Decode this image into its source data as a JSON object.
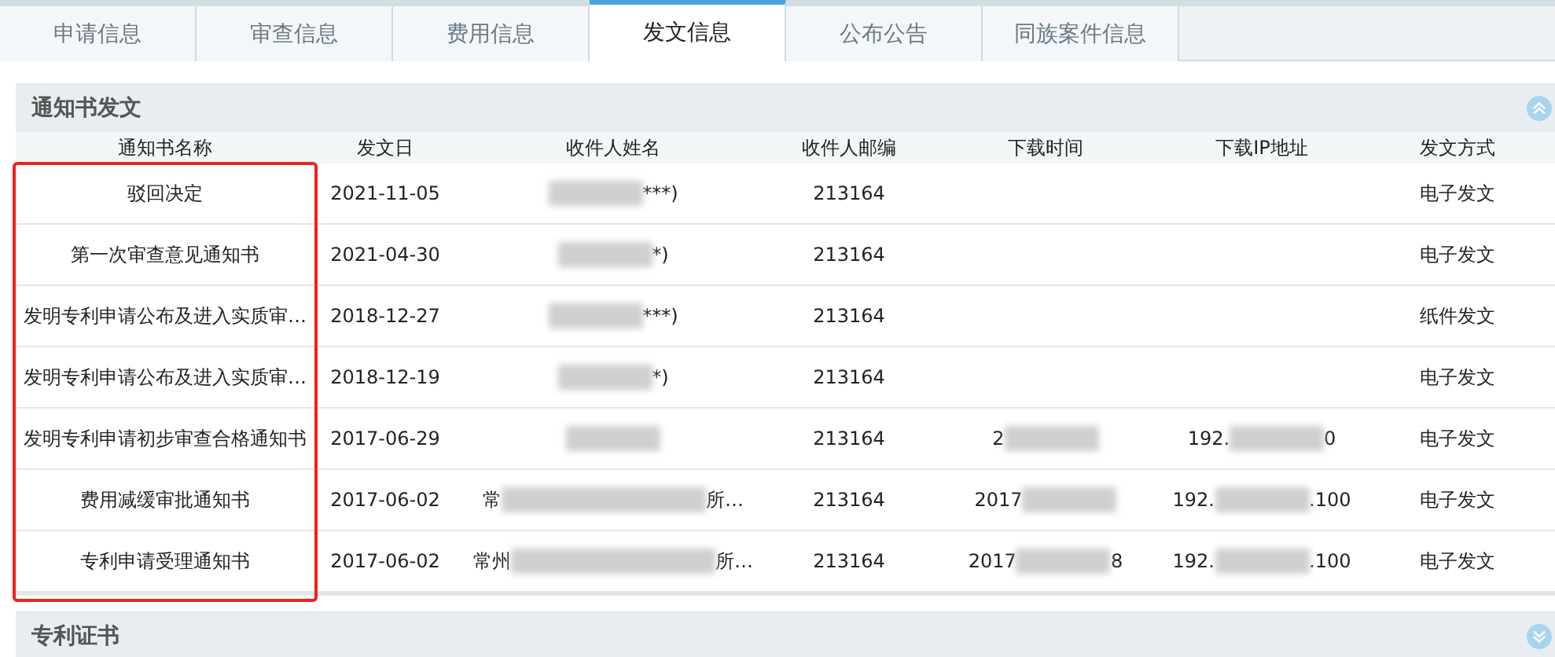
{
  "tabs": [
    {
      "label": "申请信息",
      "selected": false
    },
    {
      "label": "审查信息",
      "selected": false
    },
    {
      "label": "费用信息",
      "selected": false
    },
    {
      "label": "发文信息",
      "selected": true
    },
    {
      "label": "公布公告",
      "selected": false
    },
    {
      "label": "同族案件信息",
      "selected": false
    }
  ],
  "sections": [
    {
      "title": "通知书发文",
      "expanded": true,
      "table": {
        "highlight_first_column": true,
        "columns": [
          "通知书名称",
          "发文日",
          "收件人姓名",
          "收件人邮编",
          "下载时间",
          "下载IP地址",
          "发文方式"
        ],
        "rows": [
          {
            "name": "驳回决定",
            "date": "2021-11-05",
            "recipient": {
              "masked": true,
              "after": "***)"
            },
            "postcode": "213164",
            "method": "电子发文"
          },
          {
            "name": "第一次审查意见通知书",
            "date": "2021-04-30",
            "recipient": {
              "masked": true,
              "after": "*)"
            },
            "postcode": "213164",
            "method": "电子发文"
          },
          {
            "name": "发明专利申请公布及进入实质审…",
            "date": "2018-12-27",
            "recipient": {
              "masked": true,
              "after": "***)"
            },
            "postcode": "213164",
            "method": "纸件发文"
          },
          {
            "name": "发明专利申请公布及进入实质审…",
            "date": "2018-12-19",
            "recipient": {
              "masked": true,
              "after": "*)"
            },
            "postcode": "213164",
            "method": "电子发文"
          },
          {
            "name": "发明专利申请初步审查合格通知书",
            "date": "2017-06-29",
            "recipient": {
              "masked": true
            },
            "postcode": "213164",
            "download_time": {
              "masked": true,
              "before": "2"
            },
            "download_ip": {
              "masked": true,
              "before": "192.",
              "after": "0"
            },
            "method": "电子发文"
          },
          {
            "name": "费用减缓审批通知书",
            "date": "2017-06-02",
            "recipient": {
              "masked": true,
              "before": "常",
              "after": "所…"
            },
            "postcode": "213164",
            "download_time": {
              "masked": true,
              "before": "2017"
            },
            "download_ip": {
              "masked": true,
              "before": "192.",
              "after": ".100"
            },
            "method": "电子发文"
          },
          {
            "name": "专利申请受理通知书",
            "date": "2017-06-02",
            "recipient": {
              "masked": true,
              "before": "常州",
              "after": "所…"
            },
            "postcode": "213164",
            "download_time": {
              "masked": true,
              "before": "2017",
              "after": "8"
            },
            "download_ip": {
              "masked": true,
              "before": "192.",
              "after": ".100"
            },
            "method": "电子发文"
          }
        ]
      }
    },
    {
      "title": "专利证书",
      "expanded": false
    }
  ]
}
